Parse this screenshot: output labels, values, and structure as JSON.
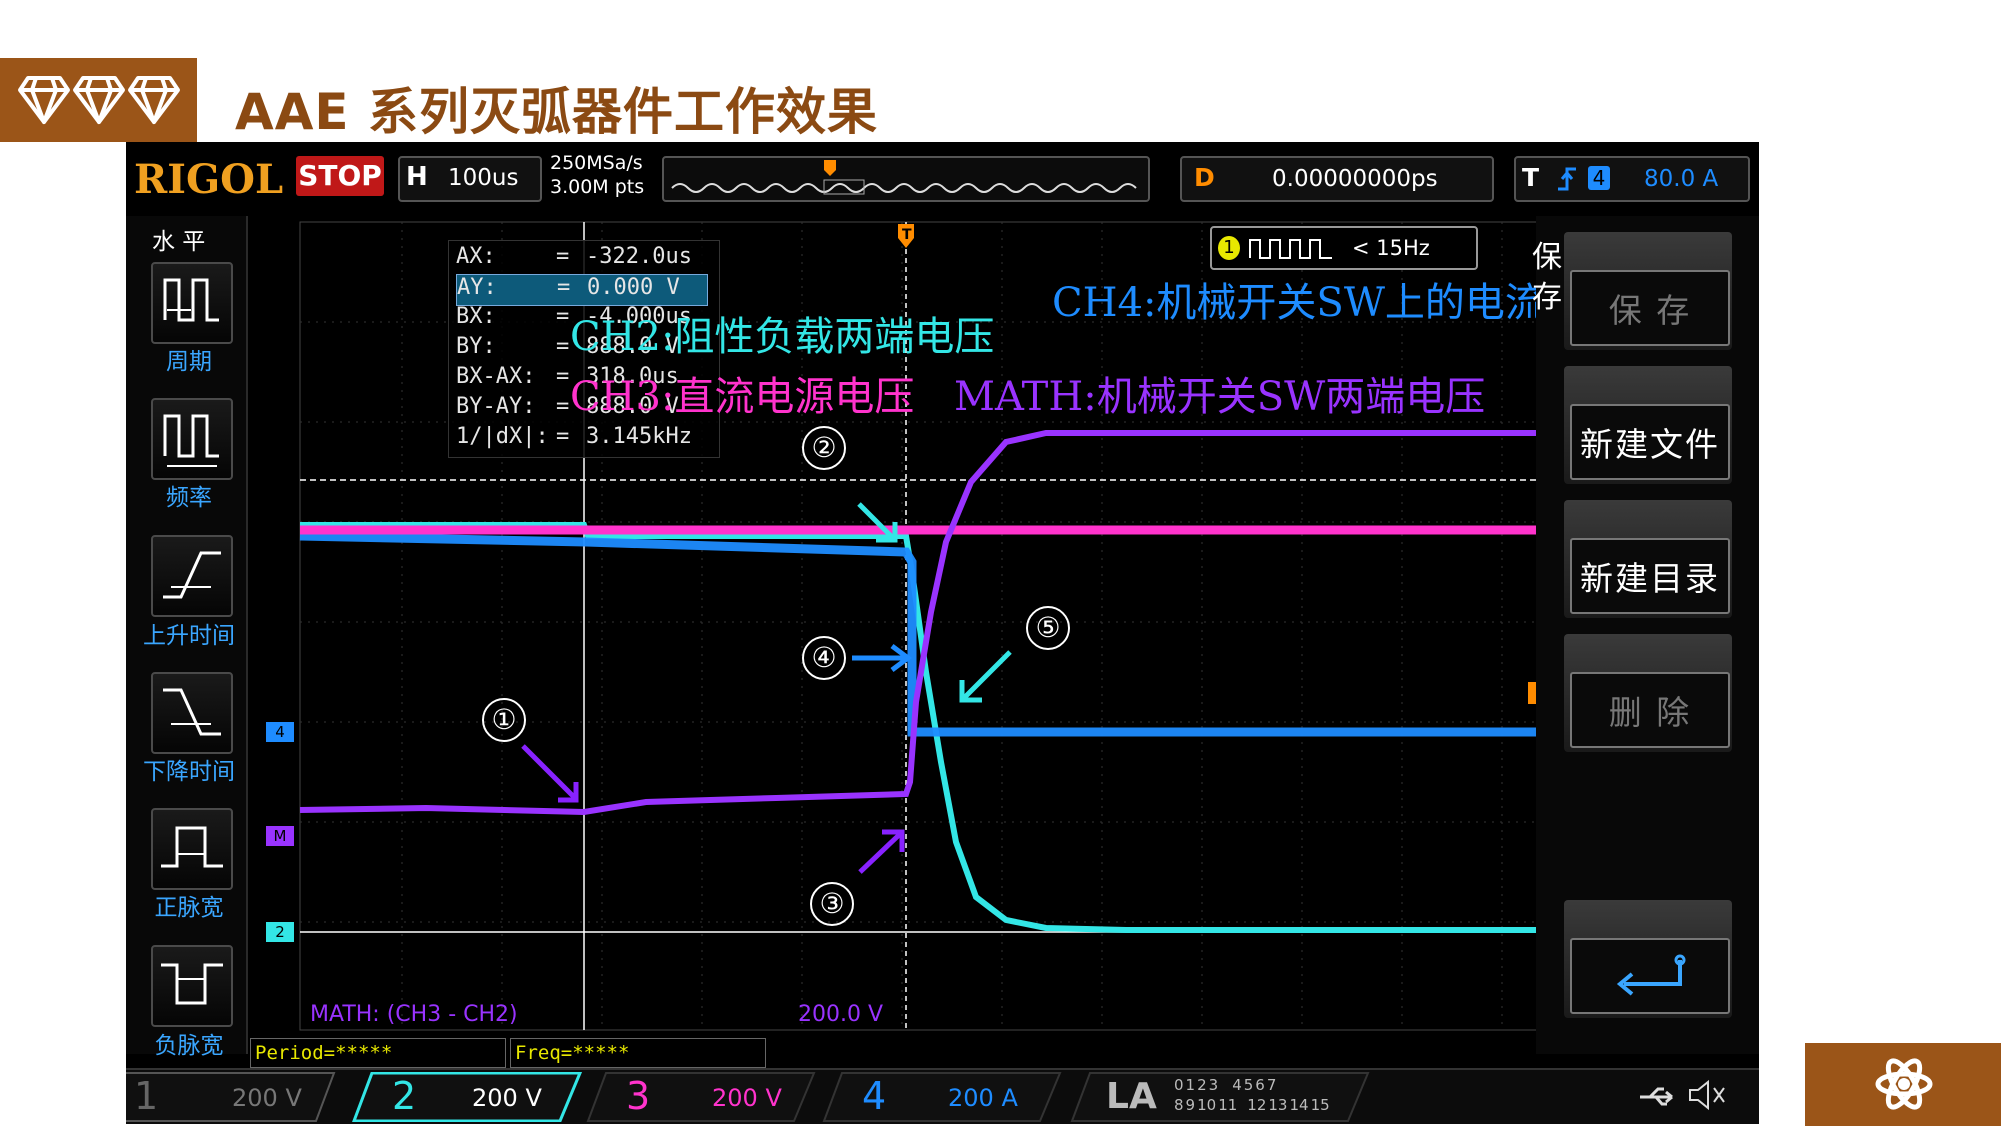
{
  "slide": {
    "title": "AAE 系列灭弧器件工作效果",
    "header_icon": "diamond-icons",
    "footer_icon": "atom-icon",
    "accent_color": "#9b5518"
  },
  "scope": {
    "brand": "RIGOL",
    "run_state": "STOP",
    "timebase_label": "H",
    "timebase_value": "100us",
    "sample_rate": "250MSa/s",
    "memory_depth": "3.00M pts",
    "delay_label": "D",
    "delay_value": "0.00000000ps",
    "trigger_label": "T",
    "trigger_source": "4",
    "trigger_level": "80.0 A",
    "left_menu": {
      "title": "水 平",
      "items": [
        {
          "label": "周期",
          "icon": "period-icon"
        },
        {
          "label": "频率",
          "icon": "frequency-icon"
        },
        {
          "label": "上升时间",
          "icon": "rise-time-icon"
        },
        {
          "label": "下降时间",
          "icon": "fall-time-icon"
        },
        {
          "label": "正脉宽",
          "icon": "positive-width-icon"
        },
        {
          "label": "负脉宽",
          "icon": "negative-width-icon"
        }
      ]
    },
    "cursor_readout": [
      {
        "name": "AX:",
        "eq": "=",
        "value": "-322.0us"
      },
      {
        "name": "AY:",
        "eq": "=",
        "value": "0.000 V"
      },
      {
        "name": "BX:",
        "eq": "=",
        "value": "-4.000us"
      },
      {
        "name": "BY:",
        "eq": "=",
        "value": "888.0 V"
      },
      {
        "name": "BX-AX:",
        "eq": "=",
        "value": "318.0us"
      },
      {
        "name": "BY-AY:",
        "eq": "=",
        "value": "888.0 V"
      },
      {
        "name": "1/|dX|:",
        "eq": "=",
        "value": "3.145kHz"
      }
    ],
    "freq_counter": {
      "channel": "1",
      "value": "< 15Hz"
    },
    "math_label": "MATH: (CH3 - CH2)",
    "math_scale": "200.0 V",
    "channel_markers": {
      "ch4": "4",
      "math": "M",
      "ch2": "2",
      "trigger": "T"
    },
    "bottom_measure": [
      "Period=*****",
      "Freq=*****"
    ],
    "right_menu": {
      "title": "保存",
      "buttons": [
        "保 存",
        "新建文件",
        "新建目录",
        "删 除"
      ],
      "back_icon": "return-icon"
    },
    "channels": [
      {
        "num": "1",
        "scale": "200 V",
        "color": "#888888"
      },
      {
        "num": "2",
        "scale": "200 V",
        "color": "#33e6e6"
      },
      {
        "num": "3",
        "scale": "200 V",
        "color": "#ff33cc"
      },
      {
        "num": "4",
        "scale": "200 A",
        "color": "#1e8cff"
      }
    ],
    "la_label": "LA",
    "la_digits": [
      "0",
      "1",
      "2",
      "3",
      "4",
      "5",
      "6",
      "7",
      "8",
      "9",
      "10",
      "11",
      "12",
      "13",
      "14",
      "15"
    ]
  },
  "annotations": {
    "ch2": "CH2:阻性负载两端电压",
    "ch3": "CH3:直流电源电压",
    "math": "MATH:机械开关SW两端电压",
    "ch4": "CH4:机械开关SW上的电流",
    "markers": [
      "①",
      "②",
      "③",
      "④",
      "⑤"
    ]
  }
}
